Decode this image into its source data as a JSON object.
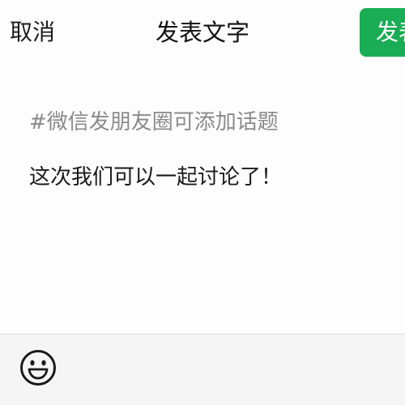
{
  "nav": {
    "cancel_label": "取消",
    "title": "发表文字",
    "publish_label": "发表"
  },
  "editor": {
    "topic_hint": "#微信发朋友圈可添加话题",
    "text": "这次我们可以一起讨论了！"
  },
  "toolbar": {
    "emoji_icon": "smiley-face-icon"
  },
  "colors": {
    "accent": "#1aad55",
    "hint": "#8a8a8a",
    "text": "#1a1a1a",
    "toolbar_bg": "#f5f5f5"
  }
}
